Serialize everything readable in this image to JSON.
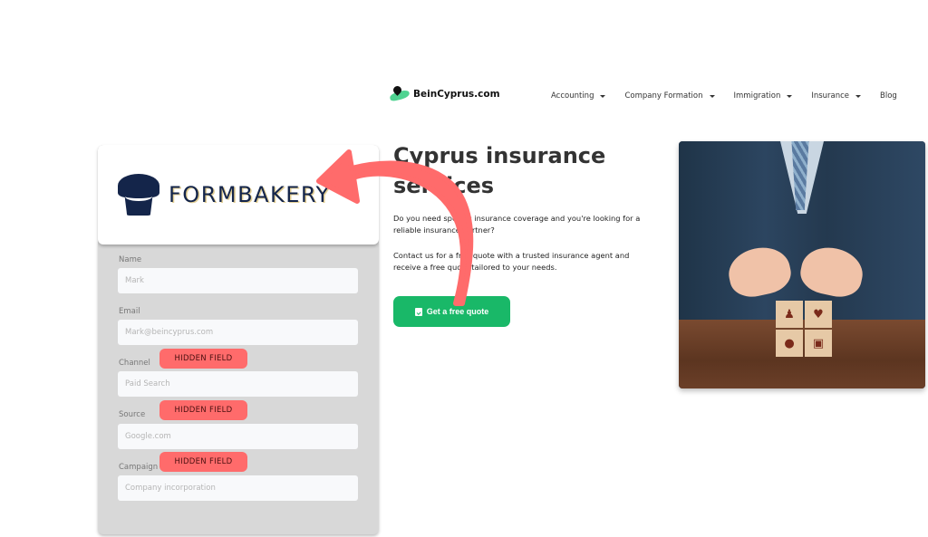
{
  "site": {
    "logo_text": "BeinCyprus.com",
    "nav": [
      {
        "label": "Accounting",
        "has_dropdown": true
      },
      {
        "label": "Company Formation",
        "has_dropdown": true
      },
      {
        "label": "Immigration",
        "has_dropdown": true
      },
      {
        "label": "Insurance",
        "has_dropdown": true
      },
      {
        "label": "Blog",
        "has_dropdown": false
      }
    ]
  },
  "hero": {
    "title": "Cyprus insurance services",
    "paragraph1": "Do you need specific insurance coverage and you're looking for a reliable insurance partner?",
    "paragraph2": "Contact us for a free quote with a trusted insurance agent and receive a free quote tailored to your needs.",
    "cta_label": "Get a free quote",
    "cta_icon": "calendar-check-icon",
    "cta_color": "#19b868"
  },
  "form": {
    "brand": "FORMBAKERY",
    "fields": [
      {
        "label": "Name",
        "placeholder": "Mark",
        "hidden": false
      },
      {
        "label": "Email",
        "placeholder": "Mark@beincyprus.com",
        "hidden": false
      },
      {
        "label": "Channel",
        "placeholder": "Paid Search",
        "hidden": true
      },
      {
        "label": "Source",
        "placeholder": "Google.com",
        "hidden": true
      },
      {
        "label": "Campaign",
        "placeholder": "Company incorporation",
        "hidden": true
      }
    ],
    "hidden_badge_label": "HIDDEN FIELD",
    "badge_color": "#ff6b6b"
  },
  "annotation": {
    "arrow_color": "#ff6b6b"
  }
}
